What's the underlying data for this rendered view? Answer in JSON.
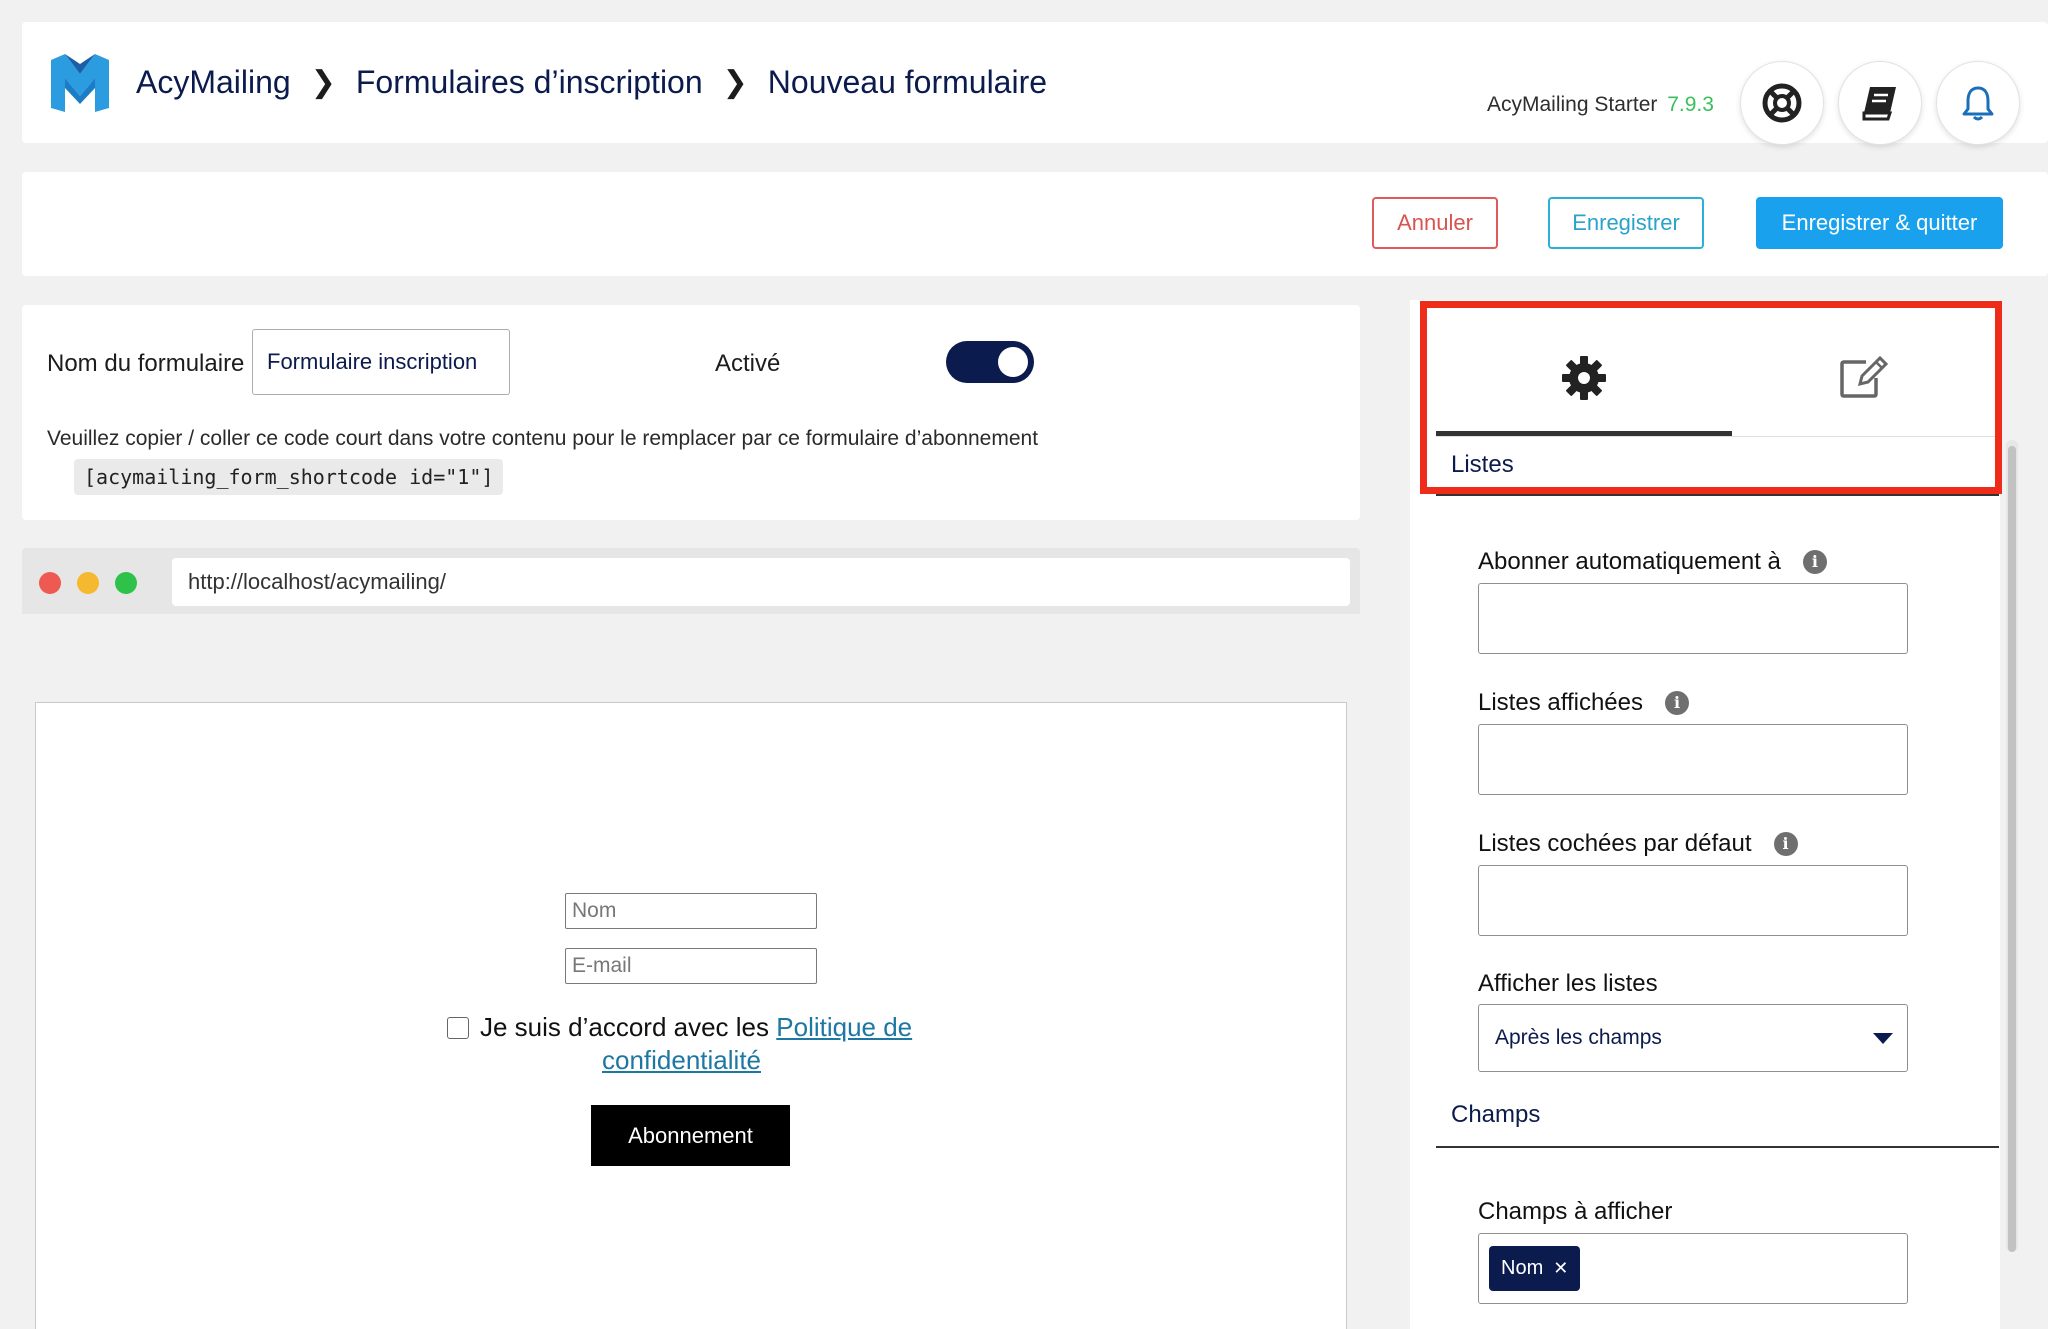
{
  "header": {
    "breadcrumb": [
      "AcyMailing",
      "Formulaires d’inscription",
      "Nouveau formulaire"
    ],
    "version_label": "AcyMailing Starter",
    "version_number": "7.9.3"
  },
  "toolbar": {
    "cancel_label": "Annuler",
    "save_label": "Enregistrer",
    "save_quit_label": "Enregistrer & quitter"
  },
  "form_info": {
    "name_label": "Nom du formulaire",
    "name_value": "Formulaire inscription",
    "active_label": "Activé",
    "active": true,
    "help_text": "Veuillez copier / coller ce code court dans votre contenu pour le remplacer par ce formulaire d’abonnement",
    "shortcode": "[acymailing_form_shortcode id=\"1\"]"
  },
  "preview": {
    "url": "http://localhost/acymailing/",
    "name_placeholder": "Nom",
    "email_placeholder": "E-mail",
    "consent_text": "Je suis d’accord avec les",
    "consent_link_line1": "Politique de",
    "consent_link_line2": "confidentialité",
    "subscribe_label": "Abonnement"
  },
  "panel": {
    "section_lists": "Listes",
    "auto_subscribe_label": "Abonner automatiquement à",
    "displayed_lists_label": "Listes affichées",
    "checked_default_label": "Listes cochées par défaut",
    "display_lists_label": "Afficher les listes",
    "display_lists_value": "Après les champs",
    "section_fields": "Champs",
    "fields_to_show_label": "Champs à afficher",
    "fields_tags": [
      "Nom"
    ]
  },
  "colors": {
    "brand_navy": "#0b1b4d",
    "primary_blue": "#1aa1ee",
    "danger": "#d9534f",
    "version_green": "#3bbf5c",
    "highlight_red": "#ef2b1a"
  }
}
